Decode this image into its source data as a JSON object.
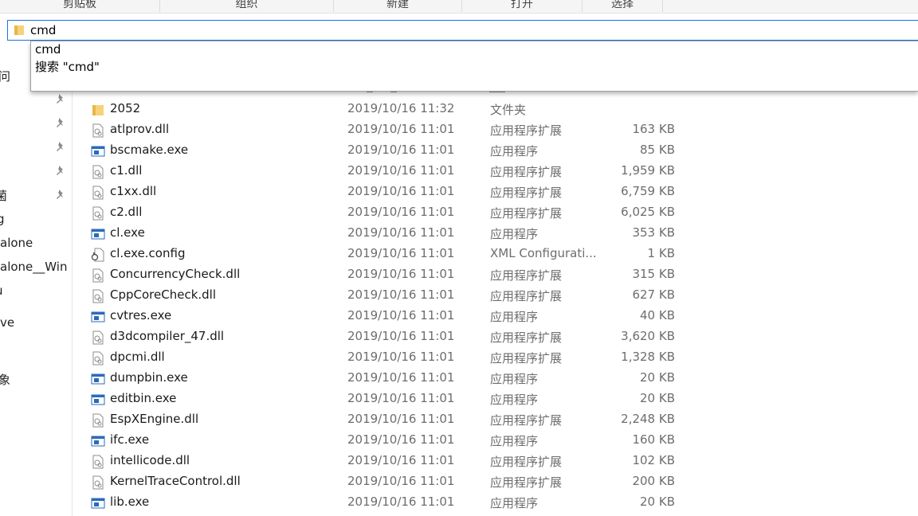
{
  "ribbon": {
    "groups": [
      "剪贴板",
      "组织",
      "新建",
      "打开",
      "选择"
    ]
  },
  "address": {
    "value": "cmd",
    "icon": "folder-icon"
  },
  "autocomplete": {
    "options": [
      "cmd",
      "搜索 \"cmd\""
    ]
  },
  "nav": {
    "items": [
      "问",
      "菌",
      "g",
      "alone",
      "alone__Win",
      "u",
      "ve",
      "象"
    ],
    "pin_icon": "pin-icon"
  },
  "files": [
    {
      "name": "2052",
      "date": "2019/10/16 11:32",
      "type": "文件夹",
      "size": "",
      "icon": "folder-icon"
    },
    {
      "name": "atlprov.dll",
      "date": "2019/10/16 11:01",
      "type": "应用程序扩展",
      "size": "163 KB",
      "icon": "dll-file-icon"
    },
    {
      "name": "bscmake.exe",
      "date": "2019/10/16 11:01",
      "type": "应用程序",
      "size": "85 KB",
      "icon": "exe-file-icon"
    },
    {
      "name": "c1.dll",
      "date": "2019/10/16 11:01",
      "type": "应用程序扩展",
      "size": "1,959 KB",
      "icon": "dll-file-icon"
    },
    {
      "name": "c1xx.dll",
      "date": "2019/10/16 11:01",
      "type": "应用程序扩展",
      "size": "6,759 KB",
      "icon": "dll-file-icon"
    },
    {
      "name": "c2.dll",
      "date": "2019/10/16 11:01",
      "type": "应用程序扩展",
      "size": "6,025 KB",
      "icon": "dll-file-icon"
    },
    {
      "name": "cl.exe",
      "date": "2019/10/16 11:01",
      "type": "应用程序",
      "size": "353 KB",
      "icon": "exe-file-icon"
    },
    {
      "name": "cl.exe.config",
      "date": "2019/10/16 11:01",
      "type": "XML Configurati...",
      "size": "1 KB",
      "icon": "config-file-icon"
    },
    {
      "name": "ConcurrencyCheck.dll",
      "date": "2019/10/16 11:01",
      "type": "应用程序扩展",
      "size": "315 KB",
      "icon": "dll-file-icon"
    },
    {
      "name": "CppCoreCheck.dll",
      "date": "2019/10/16 11:01",
      "type": "应用程序扩展",
      "size": "627 KB",
      "icon": "dll-file-icon"
    },
    {
      "name": "cvtres.exe",
      "date": "2019/10/16 11:01",
      "type": "应用程序",
      "size": "40 KB",
      "icon": "exe-file-icon"
    },
    {
      "name": "d3dcompiler_47.dll",
      "date": "2019/10/16 11:01",
      "type": "应用程序扩展",
      "size": "3,620 KB",
      "icon": "dll-file-icon"
    },
    {
      "name": "dpcmi.dll",
      "date": "2019/10/16 11:01",
      "type": "应用程序扩展",
      "size": "1,328 KB",
      "icon": "dll-file-icon"
    },
    {
      "name": "dumpbin.exe",
      "date": "2019/10/16 11:01",
      "type": "应用程序",
      "size": "20 KB",
      "icon": "exe-file-icon"
    },
    {
      "name": "editbin.exe",
      "date": "2019/10/16 11:01",
      "type": "应用程序",
      "size": "20 KB",
      "icon": "exe-file-icon"
    },
    {
      "name": "EspXEngine.dll",
      "date": "2019/10/16 11:01",
      "type": "应用程序扩展",
      "size": "2,248 KB",
      "icon": "dll-file-icon"
    },
    {
      "name": "ifc.exe",
      "date": "2019/10/16 11:01",
      "type": "应用程序",
      "size": "160 KB",
      "icon": "exe-file-icon"
    },
    {
      "name": "intellicode.dll",
      "date": "2019/10/16 11:01",
      "type": "应用程序扩展",
      "size": "102 KB",
      "icon": "dll-file-icon"
    },
    {
      "name": "KernelTraceControl.dll",
      "date": "2019/10/16 11:01",
      "type": "应用程序扩展",
      "size": "200 KB",
      "icon": "dll-file-icon"
    },
    {
      "name": "lib.exe",
      "date": "2019/10/16 11:01",
      "type": "应用程序",
      "size": "20 KB",
      "icon": "exe-file-icon"
    }
  ]
}
